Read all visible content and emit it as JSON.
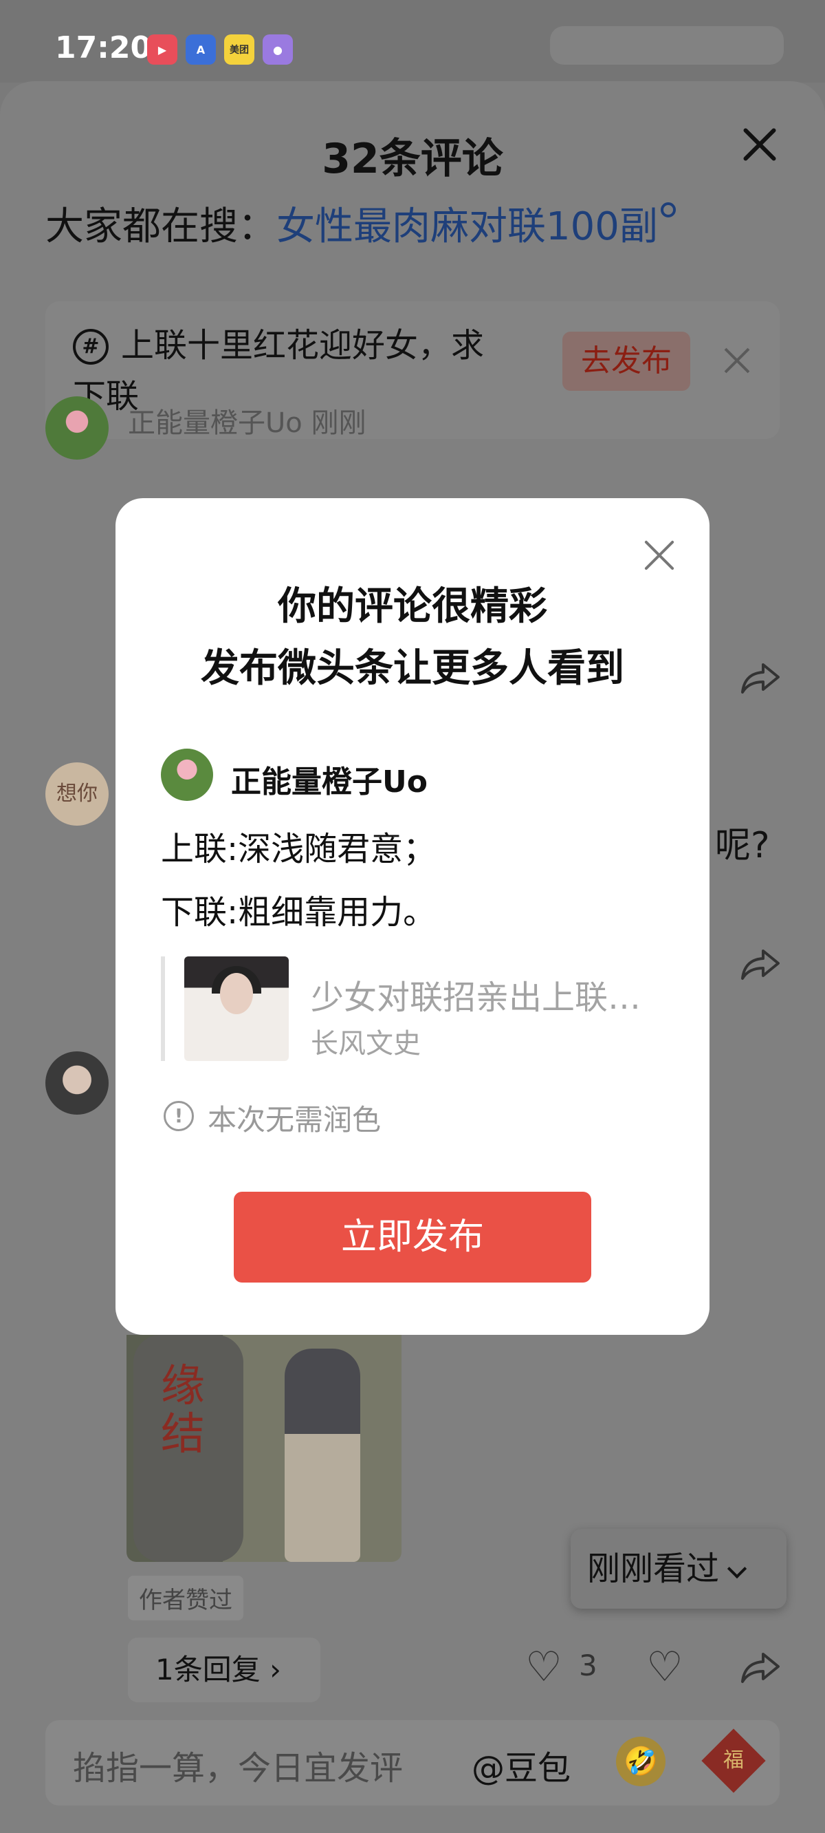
{
  "status_bar": {
    "time": "17:20",
    "app_icons": [
      "video-app-icon",
      "app-market-icon",
      "meituan-icon",
      "chat-app-icon"
    ],
    "meituan_label": "美团"
  },
  "comments_sheet": {
    "title": "32条评论",
    "search_prefix": "大家都在搜：",
    "search_query": "女性最肉麻对联100副",
    "topic": {
      "text_line1": "上联十里红花迎好女，求",
      "text_line2": "下联",
      "publish_label": "去发布"
    },
    "first_comment_meta": "正能量橙子Uo  刚刚",
    "second_avatar_text": "想你",
    "partial_text": "呢?",
    "liked_by_author": "作者赞过",
    "reply_label": "1条回复 ›",
    "like_count": "3",
    "recent_label": "刚刚看过",
    "photo_red_text": "缘结"
  },
  "input_bar": {
    "placeholder": "掐指一算，今日宜发评",
    "mention": "@豆包",
    "fu_char": "福",
    "emoji": "🤣"
  },
  "modal": {
    "title_line1": "你的评论很精彩",
    "title_line2": "发布微头条让更多人看到",
    "username": "正能量橙子Uo",
    "line1": "上联:深浅随君意；",
    "line2": "下联:粗细靠用力。",
    "quoted_title": "少女对联招亲出上联…",
    "quoted_source": "长风文史",
    "info_icon": "!",
    "info_text": "本次无需润色",
    "publish_button": "立即发布"
  },
  "colors": {
    "accent_red": "#ea5146",
    "link_blue": "#1e3f7a",
    "overlay": "#808080"
  }
}
